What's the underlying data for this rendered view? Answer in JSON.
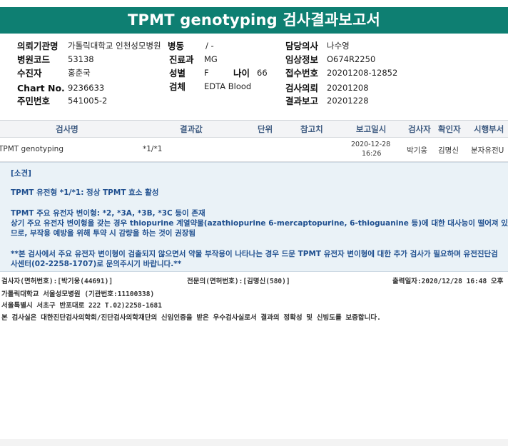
{
  "report": {
    "title": "TPMT genotyping 검사결과보고서"
  },
  "patient_info": {
    "institution_label": "의뢰기관명",
    "institution_value": "가톨릭대학교 인천성모병원",
    "ward_label": "병동",
    "ward_value": "/ -",
    "doctor_label": "담당의사",
    "doctor_value": "나수영",
    "hospital_code_label": "병원코드",
    "hospital_code_value": "53138",
    "department_label": "진료과",
    "department_value": "MG",
    "clinical_info_label": "임상정보",
    "clinical_info_value": "O674R2250",
    "recipient_label": "수진자",
    "recipient_value": "홍춘국",
    "sex_label": "성별",
    "sex_value": "F",
    "age_label": "나이",
    "age_value": "66",
    "receipt_no_label": "접수번호",
    "receipt_no_value": "20201208-12852",
    "chart_no_label": "Chart No.",
    "chart_no_value": "9236633",
    "specimen_label": "검체",
    "specimen_value": "EDTA Blood",
    "request_date_label": "검사의뢰",
    "request_date_value": "20201208",
    "resident_no_label": "주민번호",
    "resident_no_value": "541005-2",
    "report_date_label": "결과보고",
    "report_date_value": "20201228"
  },
  "results_table": {
    "headers": [
      "검사명",
      "결과값",
      "단위",
      "참고치",
      "보고일시",
      "검사자",
      "확인자",
      "시행부서"
    ],
    "rows": [
      {
        "test_name": "TPMT genotyping",
        "result": "*1/*1",
        "unit": "",
        "reference": "",
        "report_date": "2020-12-28",
        "report_time": "16:26",
        "tester": "박기웅",
        "confirmer": "김명신",
        "department": "분자유전U"
      }
    ]
  },
  "comment": {
    "heading": "[소견]",
    "line1": "TPMT 유전형 *1/*1: 정상 TPMT 효소 활성",
    "line2": "TPMT 주요 유전자 변이형: *2, *3A, *3B, *3C 등이 존재",
    "line3": "상기 주요 유전자 변이형을 갖는 경우 thiopurine 계열약물(azathiopurine 6-mercaptopurine, 6-thioguanine 등)에 대한 대사능이 떨어져 있을 수 있으",
    "line4": "므로, 부작용 예방을 위해 투약 시 감량을 하는 것이 권장됨",
    "line5": "**본 검사에서 주요 유전자 변이형이 검출되지 않으면서 약물 부작용이 나타나는 경우 드문 TPMT 유전자 변이형에 대한 추가 검사가 필요하며 유전진단검",
    "line6": "사센터(02-2258-1707)로 문의주시기 바랍니다.**"
  },
  "footer": {
    "tester_sign": "검사자(면허번호):[박기웅(44691)]",
    "specialist_sign": "전문의(면허번호):[김명신(580)]",
    "print_datetime": "출력일자:2020/12/28 16:48 오후",
    "hospital_name": "가톨릭대학교 서울성모병원 (기관번호:11100338)",
    "address": "서울특별시 서초구 반포대로 222 T.02)2258-1681",
    "certification": "본 검사실은 대한진단검사의학회/진단검사의학재단의 신임인증을 받은 우수검사실로서 결과의 정확성 및 신빙도를 보증합니다."
  }
}
